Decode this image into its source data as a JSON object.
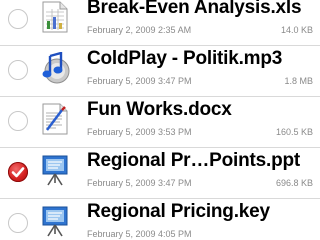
{
  "files": [
    {
      "name": "Break-Even Analysis.xls",
      "date": "February 2, 2009 2:35 AM",
      "size": "14.0 KB",
      "icon": "spreadsheet-file-icon",
      "selected": false
    },
    {
      "name": "ColdPlay - Politik.mp3",
      "date": "February 5, 2009 3:47 PM",
      "size": "1.8 MB",
      "icon": "music-file-icon",
      "selected": false
    },
    {
      "name": "Fun Works.docx",
      "date": "February 5, 2009 3:53 PM",
      "size": "160.5 KB",
      "icon": "document-file-icon",
      "selected": false
    },
    {
      "name": "Regional Pr…Points.ppt",
      "date": "February 5, 2009 3:47 PM",
      "size": "696.8 KB",
      "icon": "presentation-file-icon",
      "selected": true
    },
    {
      "name": "Regional Pricing.key",
      "date": "February 5, 2009 4:05 PM",
      "size": "",
      "icon": "presentation-file-icon",
      "selected": false
    }
  ],
  "colors": {
    "selected_check": "#d42020",
    "meta_text": "#8a8a8a",
    "separator": "#d9d9d9"
  }
}
